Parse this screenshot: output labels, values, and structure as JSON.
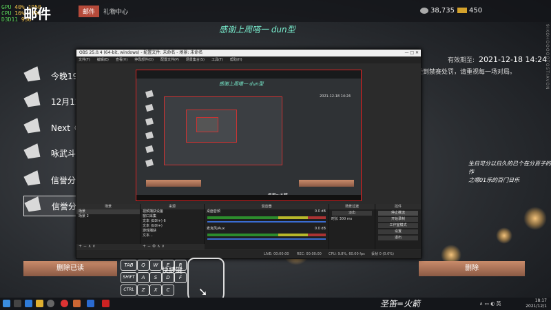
{
  "perf": {
    "gpu_label": "GPU",
    "gpu_value": "40",
    "gpu_unit": "%",
    "gpu_extra": "1950",
    "cpu_label": "CPU",
    "cpu_value": "16",
    "cpu_unit": "%",
    "cpu_extra": "4998",
    "d3d_label": "D3D11",
    "fps": "936"
  },
  "header": {
    "title": "邮件",
    "tabs": [
      {
        "label": "邮件"
      },
      {
        "label": "礼物中心"
      }
    ],
    "currency_silver": "38,735",
    "currency_gold": "450",
    "right_edge_text": "9IKOHOOOOOTOSTIAVON"
  },
  "overlay": {
    "top_text": "感谢上周嗒一 dun型",
    "side_text_line1": "生日可分以日久的已个在分百子的作",
    "side_text_line2": "之嗯01乐的百门日乐",
    "bottom_text": "圣笛=火箭",
    "keys_label": "快捷键"
  },
  "mail": {
    "expiry_label": "有效期至:",
    "expiry_value": "2021-12-18 14:24",
    "notice": "受到禁赛处罚，请重视每一场对局。",
    "items": [
      {
        "text": "今晚19:"
      },
      {
        "text": "12月12日"
      },
      {
        "text": "Next《"
      },
      {
        "text": "咏武斗剑"
      },
      {
        "text": "信誉分扣"
      },
      {
        "text": "信誉分扣"
      }
    ],
    "delete_read_label": "删除已读",
    "delete_label": "删除"
  },
  "keyboard": {
    "row1": [
      "TAB",
      "Q",
      "W",
      "E",
      "R"
    ],
    "row2": [
      "SHIFT",
      "A",
      "S",
      "D",
      "F"
    ],
    "row3": [
      "CTRL",
      "Z",
      "X",
      "C"
    ]
  },
  "obs": {
    "title": "OBS 25.0.4 (64-bit, windows) - 配置文件: 未命名 - 场景: 未命名",
    "window_controls": "— □ ✕",
    "menu": [
      "文件(F)",
      "编辑(E)",
      "查看(V)",
      "停靠部件(D)",
      "配置文件(P)",
      "场景集合(S)",
      "工具(T)",
      "帮助(H)"
    ],
    "preview": {
      "cn_text": "感谢上周嗒一 dun型",
      "date": "2021-12-18 14:24",
      "bottom_text": "圣笛=火箭"
    },
    "docks": {
      "scenes_header": "场景",
      "scenes": [
        "场景",
        "场景 2"
      ],
      "sources_header": "来源",
      "sources": [
        "视频捕获设备",
        "窗口采集",
        "文本 (GDI+) 6",
        "文本 (GDI+)",
        "游戏捕获",
        "文本..."
      ],
      "mixer_header": "混音器",
      "mixer": [
        {
          "name": "桌面音频",
          "level": "0.0 dB"
        },
        {
          "name": "麦克风/Aux",
          "level": "0.0 dB"
        }
      ],
      "transitions_header": "场景过渡",
      "transition_type": "淡出",
      "duration_label": "时长",
      "duration_value": "300 ms",
      "controls_header": "控件",
      "controls": [
        "停止推流",
        "开始录制",
        "工作室模式",
        "设置",
        "退出"
      ],
      "foot_symbols": "+ − ∧ ∨",
      "sources_foot_symbols": "+ − ⚙ ∧ ∨"
    },
    "status": {
      "live": "LIVE: 00:00:00",
      "rec": "REC: 00:00:00",
      "cpu": "CPU: 9.8%, 60.00 fps",
      "dropped": "丢帧 0 (0.0%)"
    }
  },
  "taskbar": {
    "time": "18:17",
    "date": "2021/12/1"
  }
}
